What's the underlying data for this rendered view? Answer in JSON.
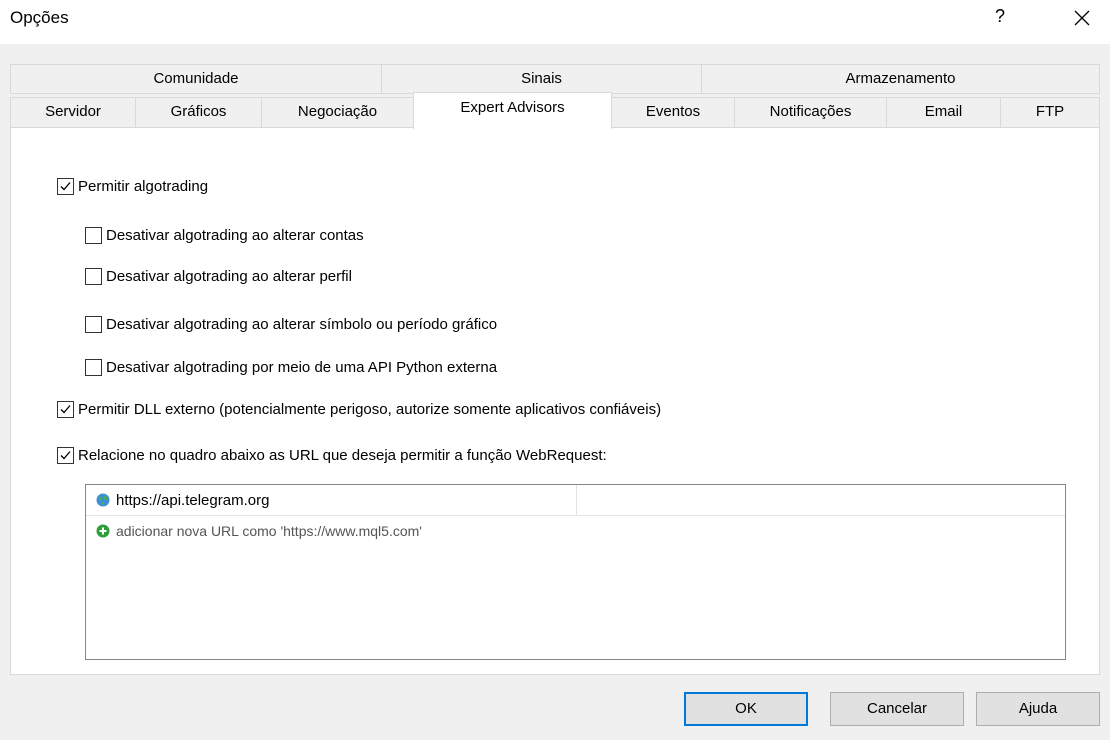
{
  "window": {
    "title": "Opções",
    "help_label": "?"
  },
  "tabs": {
    "row1": [
      "Comunidade",
      "Sinais",
      "Armazenamento"
    ],
    "row2": [
      "Servidor",
      "Gráficos",
      "Negociação",
      "Expert Advisors",
      "Eventos",
      "Notificações",
      "Email",
      "FTP"
    ],
    "active": "Expert Advisors"
  },
  "options": [
    {
      "label": "Permitir algotrading",
      "checked": true
    },
    {
      "label": "Desativar algotrading ao alterar contas",
      "checked": false
    },
    {
      "label": "Desativar algotrading ao alterar perfil",
      "checked": false
    },
    {
      "label": "Desativar algotrading ao alterar símbolo ou período gráfico",
      "checked": false
    },
    {
      "label": "Desativar algotrading por meio de uma API Python externa",
      "checked": false
    },
    {
      "label": "Permitir DLL externo (potencialmente perigoso, autorize somente aplicativos confiáveis)",
      "checked": true
    },
    {
      "label": "Relacione no quadro abaixo as URL que deseja permitir a função WebRequest:",
      "checked": true
    }
  ],
  "url_list": {
    "urls": [
      "https://api.telegram.org"
    ],
    "add_placeholder": "adicionar nova URL como 'https://www.mql5.com'"
  },
  "buttons": {
    "ok": "OK",
    "cancel": "Cancelar",
    "help": "Ajuda"
  },
  "icons": {
    "url_icon": "globe-icon",
    "add_icon": "add-circle-icon",
    "close": "close-icon"
  },
  "colors": {
    "accent": "#0078d7",
    "check": "#000000",
    "add_green": "#2e9e3a"
  }
}
